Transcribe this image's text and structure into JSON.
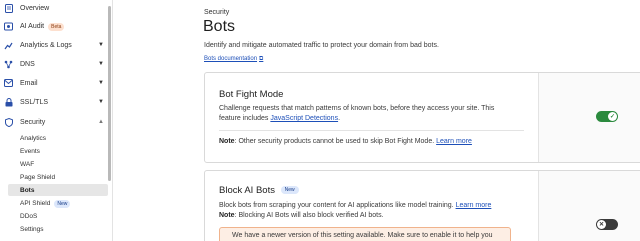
{
  "sidebar": {
    "items": [
      {
        "label": "Overview",
        "icon": "document-icon"
      },
      {
        "label": "AI Audit",
        "icon": "audit-icon",
        "badge": "Beta"
      },
      {
        "label": "Analytics & Logs",
        "icon": "chart-icon",
        "expandable": true
      },
      {
        "label": "DNS",
        "icon": "network-icon",
        "expandable": true
      },
      {
        "label": "Email",
        "icon": "email-icon",
        "expandable": true
      },
      {
        "label": "SSL/TLS",
        "icon": "lock-icon",
        "expandable": true
      },
      {
        "label": "Security",
        "icon": "shield-icon",
        "expanded": true
      }
    ],
    "security_subitems": [
      {
        "label": "Analytics"
      },
      {
        "label": "Events"
      },
      {
        "label": "WAF"
      },
      {
        "label": "Page Shield"
      },
      {
        "label": "Bots",
        "active": true
      },
      {
        "label": "API Shield",
        "badge": "New"
      },
      {
        "label": "DDoS"
      },
      {
        "label": "Settings"
      }
    ]
  },
  "page": {
    "kicker": "Security",
    "title": "Bots",
    "description": "Identify and mitigate automated traffic to protect your domain from bad bots.",
    "doc_link": "Bots documentation"
  },
  "cards": {
    "bot_fight": {
      "title": "Bot Fight Mode",
      "text1": "Challenge requests that match patterns of known bots, before they access your site. This",
      "text2_pre": "feature includes ",
      "text2_link": "JavaScript Detections",
      "text2_post": ".",
      "note_label": "Note",
      "note_text": ": Other security products cannot be used to skip Bot Fight Mode. ",
      "note_link": "Learn more",
      "enabled": true
    },
    "block_ai": {
      "title": "Block AI Bots",
      "badge": "New",
      "text1_pre": "Block bots from scraping your content for AI applications like model training. ",
      "text1_link": "Learn more",
      "note_label": "Note",
      "note_text": ": Blocking AI Bots will also block verified AI bots.",
      "notice": "We have a newer version of this setting available. Make sure to enable it to help you",
      "enabled": false
    }
  },
  "colors": {
    "toggle_on": "#2b8a3e",
    "toggle_off": "#3a3a3a",
    "link": "#1d4fb8",
    "notice_bg": "#fdeee4"
  }
}
